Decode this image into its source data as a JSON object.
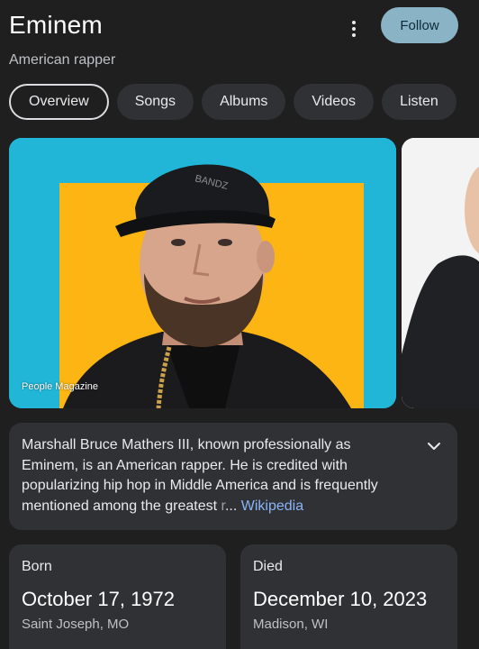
{
  "header": {
    "title": "Eminem",
    "subtitle": "American rapper",
    "follow_label": "Follow",
    "more_icon": "more-vert-icon"
  },
  "tabs": [
    {
      "label": "Overview",
      "active": true
    },
    {
      "label": "Songs",
      "active": false
    },
    {
      "label": "Albums",
      "active": false
    },
    {
      "label": "Videos",
      "active": false
    },
    {
      "label": "Listen",
      "active": false
    }
  ],
  "hero": {
    "credit": "People Magazine",
    "cap_text": "BANDZ"
  },
  "description": {
    "text_main": "Marshall Bruce Mathers III, known professionally as Eminem, is an American rapper. He is credited with popularizing hip hop in Middle America and is frequently mentioned among the greatest ",
    "text_fade": "r",
    "ellipsis": "...",
    "source": "Wikipedia",
    "expand_icon": "chevron-down-icon"
  },
  "facts": {
    "born": {
      "label": "Born",
      "date": "October 17, 1972",
      "place": "Saint Joseph, MO"
    },
    "died": {
      "label": "Died",
      "date": "December 10, 2023",
      "place": "Madison, WI"
    }
  },
  "colors": {
    "background": "#1f1f1f",
    "card": "#303134",
    "follow_button": "#8ab4c6",
    "link": "#8ab4f8",
    "hero_blue": "#21b6d8",
    "hero_yellow": "#fcb512"
  }
}
